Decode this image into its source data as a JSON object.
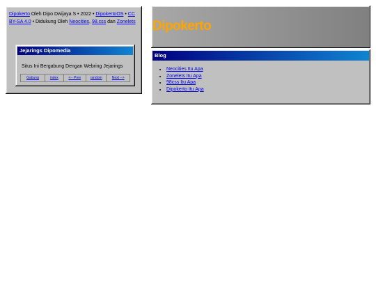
{
  "footer": {
    "site_link": "Dipokerto",
    "by_text": " Oleh Dipo Dwijaya S • 2022 • ",
    "os_link": "DipokertoOS",
    "sep1": " • ",
    "license_link": "CC BY-SA 4.0",
    "supported_text": " • Didukung Oleh ",
    "neocities_link": "Neocities",
    "comma": ", ",
    "css98_link": "98.css",
    "and_text": " dan ",
    "zonelets_link": "Zonelets"
  },
  "webring": {
    "title": "Jejarings Dipomedia",
    "description": "Situs Ini Bergabung Dengan Webring Jejarings",
    "nav": {
      "join": "Gabung",
      "index": "index",
      "prev": "<-- Prev",
      "random": "random",
      "next": "Next -->"
    }
  },
  "header": {
    "title": "Dipokerto"
  },
  "blog": {
    "title": "Blog",
    "items": [
      "Neocities Itu Apa",
      "Zonelets Itu Apa",
      "98css Itu Apa",
      "Dipokerto Itu Apa"
    ]
  },
  "colors": {
    "title_bar_start": "#000080",
    "title_bar_end": "#1084d0",
    "panel_bg": "#c0c0c0",
    "site_title": "#ffa500",
    "link": "#0000ee"
  }
}
